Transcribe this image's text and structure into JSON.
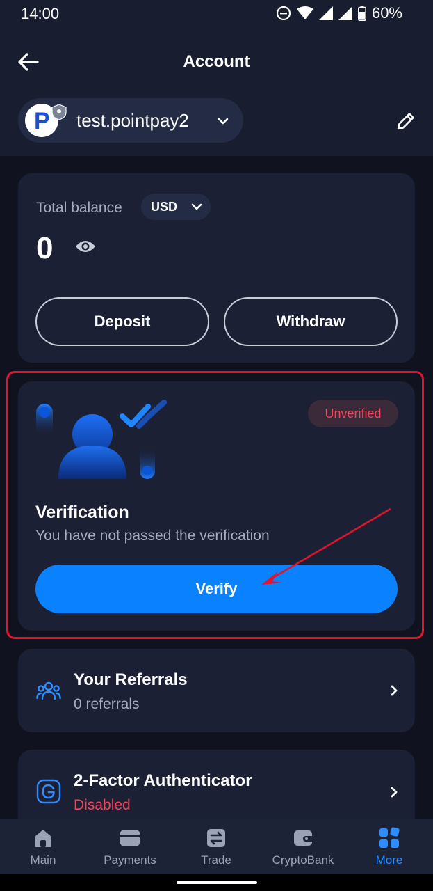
{
  "status_bar": {
    "time": "14:00",
    "battery": "60%"
  },
  "header": {
    "title": "Account"
  },
  "account": {
    "name": "test.pointpay2",
    "avatar_letter": "P"
  },
  "balance": {
    "label": "Total balance",
    "currency": "USD",
    "value": "0",
    "deposit_label": "Deposit",
    "withdraw_label": "Withdraw"
  },
  "verification": {
    "status": "Unverified",
    "title": "Verification",
    "subtitle": "You have not passed the verification",
    "button_label": "Verify"
  },
  "menu": [
    {
      "title": "Your Referrals",
      "subtitle": "0 referrals",
      "icon": "users-icon"
    },
    {
      "title": "2-Factor Authenticator",
      "subtitle": "Disabled",
      "icon": "google-authenticator-icon"
    }
  ],
  "bottom_nav": [
    {
      "label": "Main",
      "icon": "home-icon"
    },
    {
      "label": "Payments",
      "icon": "card-icon"
    },
    {
      "label": "Trade",
      "icon": "exchange-icon"
    },
    {
      "label": "CryptoBank",
      "icon": "wallet-icon"
    },
    {
      "label": "More",
      "icon": "grid-icon",
      "active": true
    }
  ],
  "colors": {
    "background": "#10131f",
    "card": "#1b2034",
    "accent": "#0a82ff",
    "danger": "#f0455a",
    "highlight": "#e0142d"
  }
}
